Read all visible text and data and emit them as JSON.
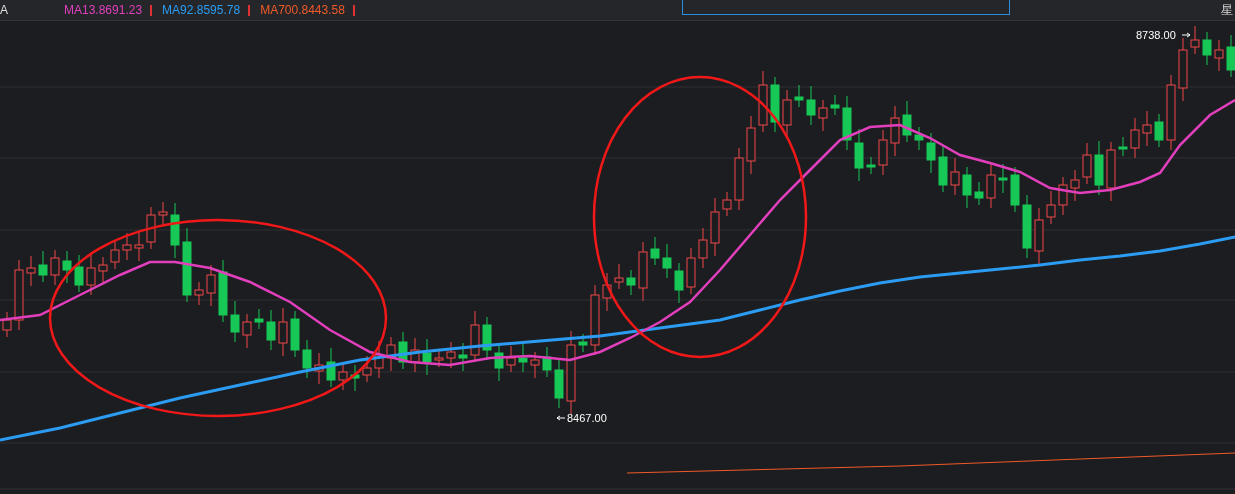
{
  "toolbar": {
    "prefix": "A",
    "indicators": [
      {
        "label": "MA13.8691.23",
        "color": "#e23fbd"
      },
      {
        "label": "MA92.8595.78",
        "color": "#2b9cf2"
      },
      {
        "label": "MA700.8443.58",
        "color": "#f05a28"
      }
    ],
    "right_label": "星"
  },
  "chart": {
    "high_mark": "8738.00",
    "low_mark": "8467.00"
  }
}
